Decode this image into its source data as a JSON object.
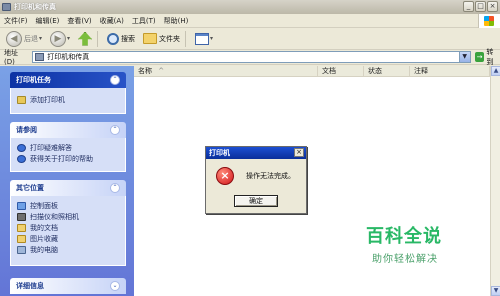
{
  "window": {
    "title": "打印机和传真",
    "controls": {
      "minimize": "_",
      "maximize": "□",
      "close": "×"
    }
  },
  "menu": [
    "文件(F)",
    "编辑(E)",
    "查看(V)",
    "收藏(A)",
    "工具(T)",
    "帮助(H)"
  ],
  "toolbar": {
    "back_label": "后退",
    "forward_icon": "forward-arrow-icon",
    "up_icon": "up-folder-icon",
    "search_label": "搜索",
    "folders_label": "文件夹",
    "views_icon": "views-icon"
  },
  "address": {
    "label": "地址(D)",
    "value": "打印机和传真",
    "go_label": "转到"
  },
  "taskpane": {
    "printer_tasks": {
      "title": "打印机任务",
      "items": [
        "添加打印机"
      ]
    },
    "see_also": {
      "title": "请参阅",
      "items": [
        "打印疑难解答",
        "获得关于打印的帮助"
      ]
    },
    "other_places": {
      "title": "其它位置",
      "items": [
        "控制面板",
        "扫描仪和照相机",
        "我的文档",
        "图片收藏",
        "我的电脑"
      ]
    },
    "details": {
      "title": "详细信息"
    }
  },
  "list": {
    "columns": [
      "名称",
      "文档",
      "状态",
      "注释"
    ],
    "sort_indicator": "^"
  },
  "dialog": {
    "title": "打印机",
    "close_glyph": "×",
    "icon": "error-icon",
    "message": "操作无法完成。",
    "ok_label": "确定"
  },
  "watermark": {
    "brand": "百科全说",
    "subtitle": "助你轻松解决"
  },
  "colors": {
    "taskpane_top": "#7aa1e6",
    "taskpane_bottom": "#6375d6",
    "dialog_title": "#0a2e9a",
    "error_red": "#d2141a",
    "watermark_green": "#29b866"
  }
}
